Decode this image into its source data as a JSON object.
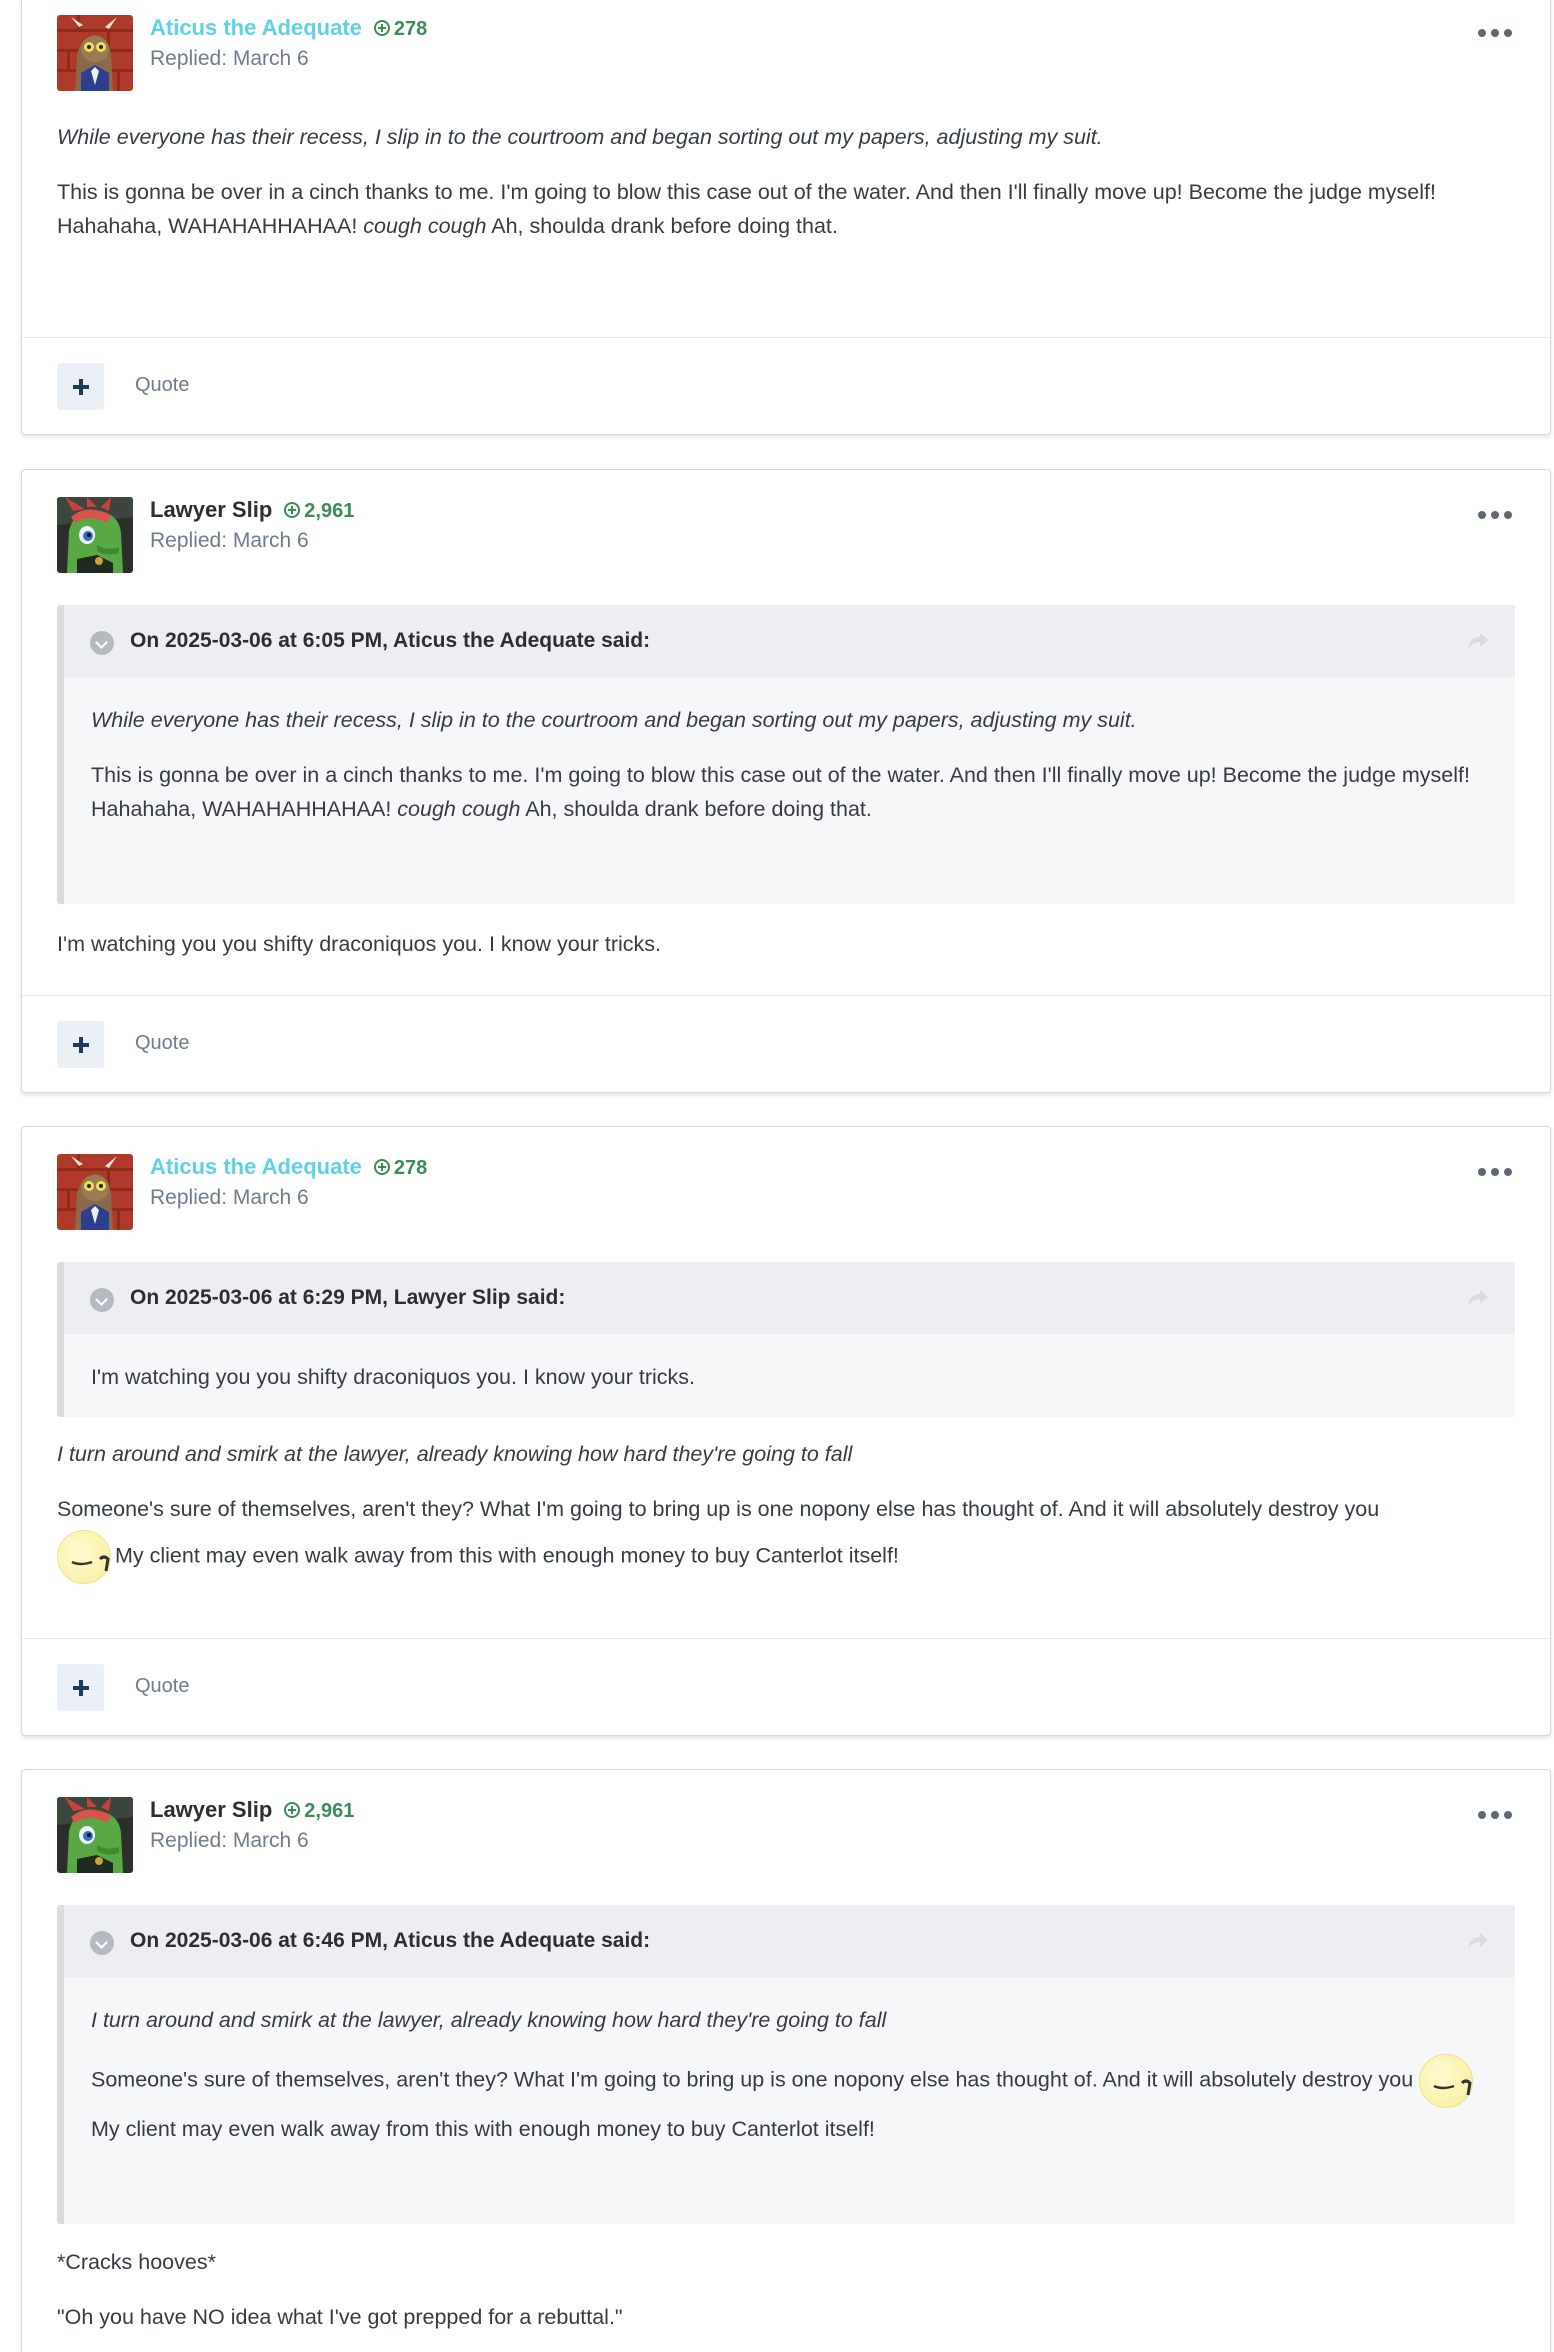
{
  "posts": [
    {
      "author": "Aticus the Adequate",
      "reputation": "278",
      "replied": "Replied: March 6",
      "avatar": "discord-avatar",
      "body": {
        "p1": "While everyone has their recess, I slip in to the courtroom and began sorting out my papers, adjusting my suit.",
        "p2a": "This is gonna be over in a cinch thanks to me. I'm going to blow this case out of the water. And then I'll finally move up! Become the judge myself! Hahahaha, WAHAHAHHAHAA! ",
        "p2b": "cough cough",
        "p2c": " Ah, shoulda drank before doing that."
      }
    },
    {
      "author": "Lawyer Slip",
      "reputation": "2,961",
      "replied": "Replied: March 6",
      "avatar": "green-dragon-avatar",
      "quote": {
        "title": "On 2025-03-06 at 6:05 PM, Aticus the Adequate said:",
        "p1": "While everyone has their recess, I slip in to the courtroom and began sorting out my papers, adjusting my suit.",
        "p2a": "This is gonna be over in a cinch thanks to me. I'm going to blow this case out of the water. And then I'll finally move up! Become the judge myself! Hahahaha, WAHAHAHHAHAA! ",
        "p2b": "cough cough",
        "p2c": " Ah, shoulda drank before doing that."
      },
      "body": {
        "p1": "I'm watching you you shifty draconiquos you. I know your tricks."
      }
    },
    {
      "author": "Aticus the Adequate",
      "reputation": "278",
      "replied": "Replied: March 6",
      "avatar": "discord-avatar",
      "quote": {
        "title": "On 2025-03-06 at 6:29 PM, Lawyer Slip said:",
        "p1": "I'm watching you you shifty draconiquos you. I know your tricks."
      },
      "body": {
        "p1": "I turn around and smirk at the lawyer, already knowing how hard they're going to fall",
        "p2a": "Someone's sure of themselves, aren't they? What I'm going to bring up is one nopony else has thought of. And it will absolutely destroy you ",
        "p2b": "My client may even walk away from this with enough money to buy Canterlot itself!"
      }
    },
    {
      "author": "Lawyer Slip",
      "reputation": "2,961",
      "replied": "Replied: March 6",
      "avatar": "green-dragon-avatar",
      "quote": {
        "title": "On 2025-03-06 at 6:46 PM, Aticus the Adequate said:",
        "p1": "I turn around and smirk at the lawyer, already knowing how hard they're going to fall",
        "p2a": "Someone's sure of themselves, aren't they? What I'm going to bring up is one nopony else has thought of. And it will absolutely destroy you ",
        "p2b": "My client may even walk away from this with enough money to buy Canterlot itself!"
      },
      "body": {
        "p1": "*Cracks hooves*",
        "p2": "\"Oh you have NO idea what I've got prepped for a rebuttal.\""
      }
    }
  ],
  "footer": {
    "quote_label": "Quote"
  },
  "icons": {
    "more": "ellipsis-icon",
    "plus": "plus-icon",
    "toggle": "chevron-down-icon",
    "share": "share-arrow-icon",
    "reputation": "plus-circle-icon",
    "emoji": "smirk-emoji-icon"
  },
  "colors": {
    "author_teal": "#5fd1e6",
    "reputation_green": "#3c8c57",
    "plus_button_bg": "#eaf0f6"
  }
}
